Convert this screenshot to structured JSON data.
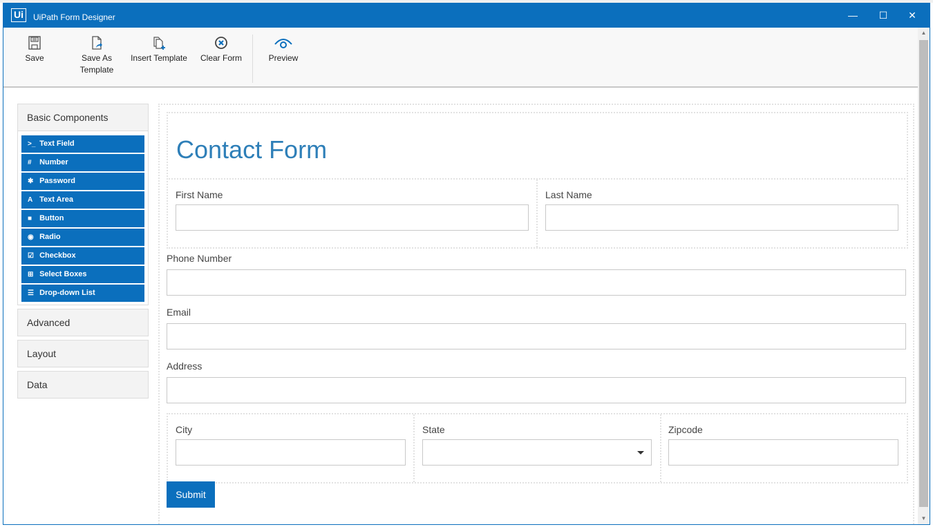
{
  "window": {
    "title": "UiPath Form Designer",
    "logo_text": "Ui",
    "controls": {
      "minimize": "—",
      "maximize": "☐",
      "close": "✕"
    }
  },
  "toolbar": {
    "buttons": [
      {
        "label": "Save",
        "icon": "floppy-disk-icon"
      },
      {
        "label": "Save As Template",
        "icon": "file-export-icon"
      },
      {
        "label": "Insert Template",
        "icon": "file-copy-add-icon"
      },
      {
        "label": "Clear Form",
        "icon": "circle-x-icon"
      },
      {
        "label": "Preview",
        "icon": "eye-icon"
      }
    ]
  },
  "sidebar": {
    "panels": [
      {
        "title": "Basic Components",
        "expanded": true,
        "components": [
          {
            "label": "Text Field",
            "icon": ">_"
          },
          {
            "label": "Number",
            "icon": "#"
          },
          {
            "label": "Password",
            "icon": "✱"
          },
          {
            "label": "Text Area",
            "icon": "A"
          },
          {
            "label": "Button",
            "icon": "■"
          },
          {
            "label": "Radio",
            "icon": "◉"
          },
          {
            "label": "Checkbox",
            "icon": "☑"
          },
          {
            "label": "Select Boxes",
            "icon": "⊞"
          },
          {
            "label": "Drop-down List",
            "icon": "☰"
          }
        ]
      },
      {
        "title": "Advanced",
        "expanded": false
      },
      {
        "title": "Layout",
        "expanded": false
      },
      {
        "title": "Data",
        "expanded": false
      }
    ]
  },
  "form": {
    "title": "Contact Form",
    "fields": {
      "first_name": {
        "label": "First Name",
        "value": ""
      },
      "last_name": {
        "label": "Last Name",
        "value": ""
      },
      "phone": {
        "label": "Phone Number",
        "value": ""
      },
      "email": {
        "label": "Email",
        "value": ""
      },
      "address": {
        "label": "Address",
        "value": ""
      },
      "city": {
        "label": "City",
        "value": ""
      },
      "state": {
        "label": "State",
        "value": ""
      },
      "zipcode": {
        "label": "Zipcode",
        "value": ""
      }
    },
    "submit_label": "Submit"
  },
  "colors": {
    "brand": "#0b6fbd",
    "title_text": "#2e7fb8"
  }
}
